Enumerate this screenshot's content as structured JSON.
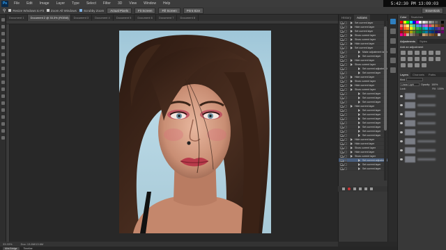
{
  "app": {
    "logo": "Ps",
    "clock": "5:42:30 PM 13:09:03"
  },
  "menu": [
    "File",
    "Edit",
    "Image",
    "Layer",
    "Type",
    "Select",
    "Filter",
    "3D",
    "View",
    "Window",
    "Help"
  ],
  "options_bar": {
    "resize_windows": "Resize Windows to Fit",
    "zoom_all": "Zoom All Windows",
    "scrubby_zoom": "Scrubby Zoom",
    "actual_pixels": "Actual Pixels",
    "fit_screen": "Fit Screen",
    "fill_screen": "Fill Screen",
    "print_size": "Print Size",
    "workspace": "Essentials"
  },
  "doc_tabs": [
    {
      "label": "Document 1",
      "active": false
    },
    {
      "label": "Document 2 @ 33.3% (RGB/8)",
      "active": true
    },
    {
      "label": "Document 3",
      "active": false
    },
    {
      "label": "Document 4",
      "active": false
    },
    {
      "label": "Document 5",
      "active": false
    },
    {
      "label": "Document 6",
      "active": false
    },
    {
      "label": "Document 7",
      "active": false
    },
    {
      "label": "Document 8",
      "active": false
    }
  ],
  "status": {
    "zoom": "33.33%",
    "doc": "Doc: 13.6M/13.6M"
  },
  "bottom_tabs": [
    {
      "label": "Mini Bridge",
      "on": true
    },
    {
      "label": "Timeline",
      "on": false
    }
  ],
  "actions_panel": {
    "tabs": [
      "History",
      "Actions"
    ],
    "items": [
      {
        "label": "Set current layer",
        "indent": false,
        "sel": false
      },
      {
        "label": "Hide current layer",
        "indent": false,
        "sel": false
      },
      {
        "label": "Set current layer",
        "indent": false,
        "sel": false
      },
      {
        "label": "Show current layer",
        "indent": false,
        "sel": false
      },
      {
        "label": "Show current layer",
        "indent": false,
        "sel": false
      },
      {
        "label": "Hide current layer",
        "indent": false,
        "sel": false
      },
      {
        "label": "Set current layer",
        "indent": false,
        "sel": false
      },
      {
        "label": "Make adjustment layer",
        "indent": true,
        "sel": false
      },
      {
        "label": "Set current layer",
        "indent": true,
        "sel": false
      },
      {
        "label": "Hide current layer",
        "indent": false,
        "sel": false
      },
      {
        "label": "Show current layer",
        "indent": false,
        "sel": false
      },
      {
        "label": "Set current adjustment layer",
        "indent": true,
        "sel": false
      },
      {
        "label": "Set current layer",
        "indent": true,
        "sel": false
      },
      {
        "label": "Hide current layer",
        "indent": false,
        "sel": false
      },
      {
        "label": "Show current layer",
        "indent": false,
        "sel": false
      },
      {
        "label": "Hide current layer",
        "indent": false,
        "sel": false
      },
      {
        "label": "Show current layer",
        "indent": false,
        "sel": false
      },
      {
        "label": "Set current layer",
        "indent": true,
        "sel": false
      },
      {
        "label": "Set current layer",
        "indent": true,
        "sel": false
      },
      {
        "label": "Set current layer",
        "indent": true,
        "sel": false
      },
      {
        "label": "Hide current layer",
        "indent": false,
        "sel": false
      },
      {
        "label": "Set current layer",
        "indent": true,
        "sel": false
      },
      {
        "label": "Set current layer",
        "indent": true,
        "sel": false
      },
      {
        "label": "Set current layer",
        "indent": true,
        "sel": false
      },
      {
        "label": "Set current layer",
        "indent": true,
        "sel": false
      },
      {
        "label": "Set current layer",
        "indent": true,
        "sel": false
      },
      {
        "label": "Set current layer",
        "indent": true,
        "sel": false
      },
      {
        "label": "Set current layer",
        "indent": true,
        "sel": false
      },
      {
        "label": "Hide current layer",
        "indent": false,
        "sel": false
      },
      {
        "label": "Hide current layer",
        "indent": false,
        "sel": false
      },
      {
        "label": "Show current layer",
        "indent": false,
        "sel": false
      },
      {
        "label": "Hide current layer",
        "indent": false,
        "sel": false
      },
      {
        "label": "Show current layer",
        "indent": false,
        "sel": false
      },
      {
        "label": "Set current adjustment",
        "indent": true,
        "sel": true
      },
      {
        "label": "Set current layer",
        "indent": true,
        "sel": false
      },
      {
        "label": "Set current layer",
        "indent": true,
        "sel": false
      }
    ]
  },
  "right_panels": {
    "swatch_tabs": [
      "Color",
      "Swatches"
    ],
    "swatches": [
      "#ff0000",
      "#ffff00",
      "#00ff00",
      "#00ffff",
      "#0000ff",
      "#ff00ff",
      "#ffffff",
      "#e0e0e0",
      "#c0c0c0",
      "#a0a0a0",
      "#808080",
      "#606060",
      "#404040",
      "#000000",
      "#ff6f6f",
      "#ffa060",
      "#fff070",
      "#90e070",
      "#40c0a0",
      "#40a0e0",
      "#6070e0",
      "#a060e0",
      "#e060c0",
      "#e04070",
      "#c08050",
      "#a06030",
      "#704020",
      "#402010",
      "#ee1c24",
      "#f26522",
      "#f7941d",
      "#fff200",
      "#8dc63f",
      "#39b54a",
      "#00a651",
      "#00a99d",
      "#00aeef",
      "#0072bc",
      "#0054a6",
      "#2e3192",
      "#662d91",
      "#92278f",
      "#9e0b0f",
      "#a0410d",
      "#a36209",
      "#aba000",
      "#598527",
      "#197b30",
      "#007236",
      "#00746b",
      "#0076a3",
      "#004a80",
      "#003471",
      "#1b1464",
      "#440e62",
      "#630460",
      "#ec008c",
      "#ed145b",
      "#c7b299",
      "#998675",
      "#736357",
      "#534741",
      "#37302a",
      "#c69c6d",
      "#a67c52",
      "#8c6239",
      "#754c24",
      "#603913",
      "#c2c2c2",
      "#3a3a3a"
    ],
    "adj_tabs": [
      "Adjustments",
      "Styles"
    ],
    "adj_title": "Add an adjustment",
    "layer_tabs": [
      "Layers",
      "Channels",
      "Paths"
    ],
    "kind": "Kind",
    "blend": "Linear Light",
    "opacity_label": "Opacity:",
    "opacity": "100%",
    "lock_label": "Lock:",
    "fill_label": "Fill:",
    "fill": "100%"
  }
}
